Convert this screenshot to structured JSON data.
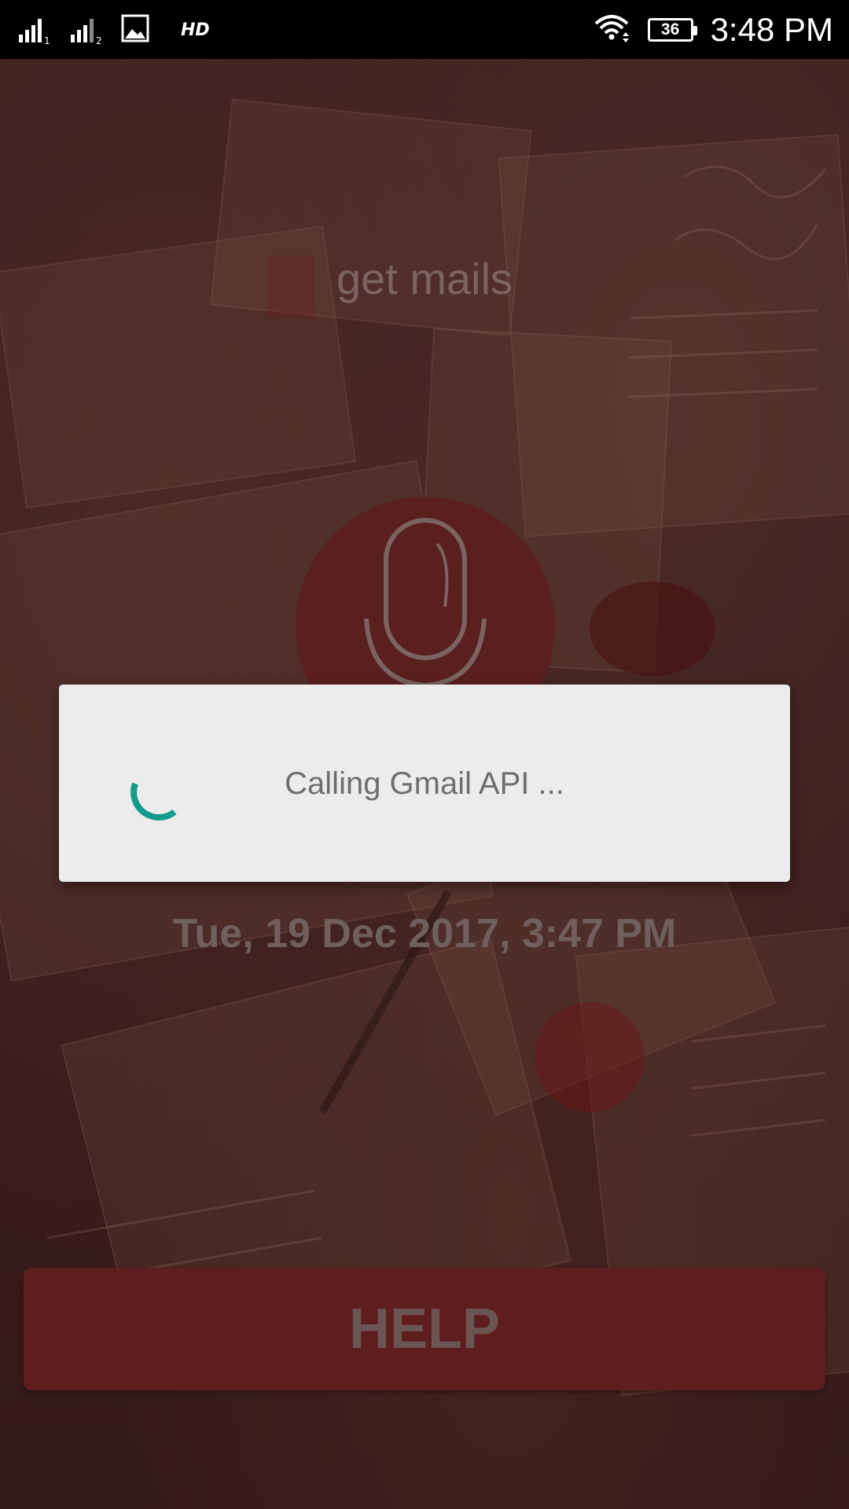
{
  "status_bar": {
    "sim1_label": "1",
    "sim2_label": "2",
    "network_type": "HD",
    "battery_level": "36",
    "time": "3:48 PM",
    "icons": [
      "signal-icon",
      "signal-icon",
      "image-notification-icon",
      "wifi-icon",
      "battery-icon"
    ]
  },
  "main": {
    "title": "get mails",
    "mic_icon": "microphone-icon",
    "date": "Tue, 19 Dec 2017, 3:47 PM",
    "help_label": "HELP"
  },
  "dialog": {
    "message": "Calling Gmail API ...",
    "spinner_icon": "progress-spinner-icon",
    "accent_color": "#139b8c"
  },
  "colors": {
    "status_bar_bg": "#000000",
    "primary_dark_red": "#5e1d1f",
    "dialog_bg": "#ececec"
  }
}
